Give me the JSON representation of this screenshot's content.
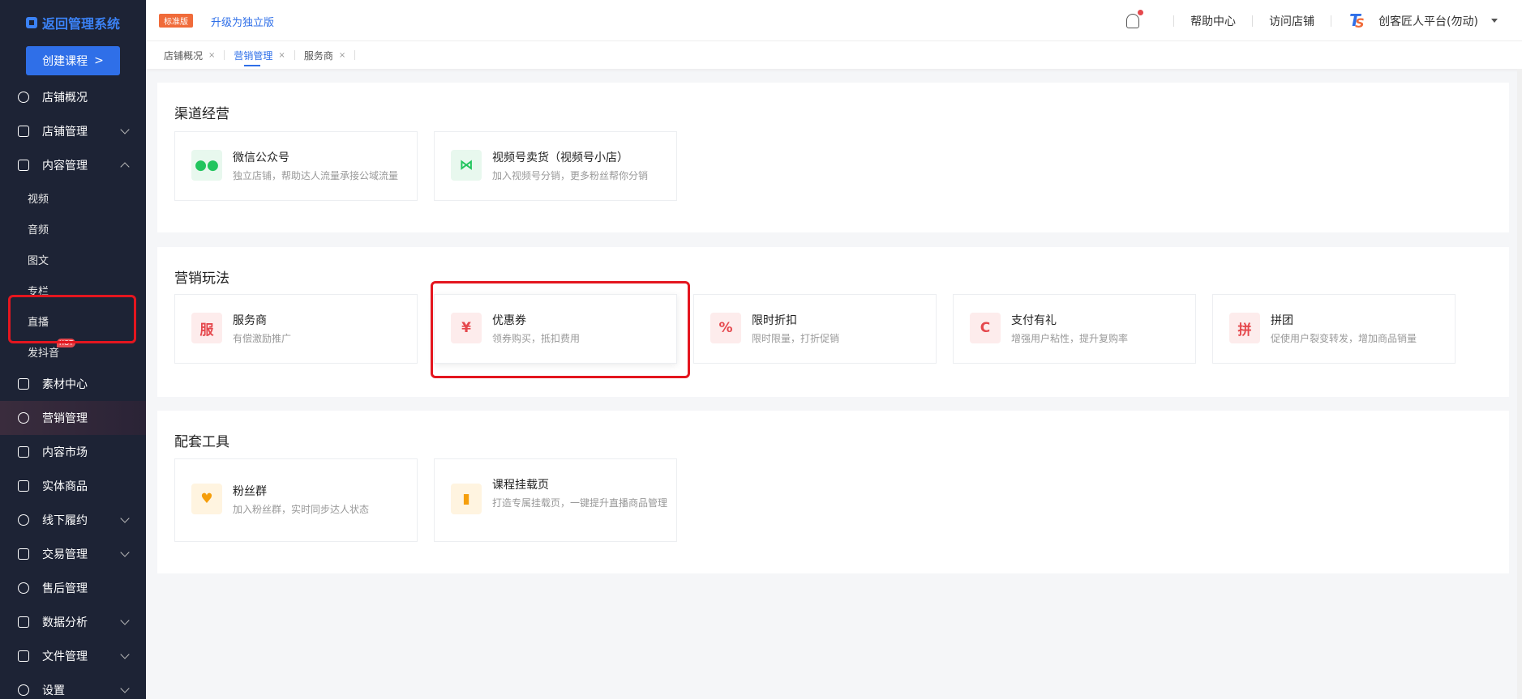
{
  "sidebar": {
    "brand": "返回管理系统",
    "create_button": "创建课程",
    "items": [
      {
        "label": "店铺概况"
      },
      {
        "label": "店铺管理"
      },
      {
        "label": "内容管理"
      },
      {
        "label": "素材中心"
      },
      {
        "label": "营销管理"
      },
      {
        "label": "内容市场"
      },
      {
        "label": "实体商品"
      },
      {
        "label": "线下履约"
      },
      {
        "label": "交易管理"
      },
      {
        "label": "售后管理"
      },
      {
        "label": "数据分析"
      },
      {
        "label": "文件管理"
      },
      {
        "label": "设置"
      }
    ],
    "content_sub": [
      "视频",
      "音频",
      "图文",
      "专栏",
      "直播",
      "发抖音"
    ],
    "hot_badge": "HOT"
  },
  "header": {
    "edition_badge": "标准版",
    "upgrade_link": "升级为独立版",
    "help": "帮助中心",
    "visit_store": "访问店铺",
    "account": "创客匠人平台(勿动)"
  },
  "tabs": [
    {
      "label": "店铺概况",
      "close": "×"
    },
    {
      "label": "营销管理",
      "close": "×"
    },
    {
      "label": "服务商",
      "close": "×"
    }
  ],
  "sections": {
    "channel": {
      "title": "渠道经营",
      "cards": [
        {
          "title": "微信公众号",
          "desc": "独立店铺，帮助达人流量承接公域流量",
          "icon": "wechat-icon"
        },
        {
          "title": "视频号卖货（视频号小店）",
          "desc": "加入视频号分销，更多粉丝帮你分销",
          "icon": "share-icon"
        }
      ]
    },
    "marketing": {
      "title": "营销玩法",
      "cards": [
        {
          "title": "服务商",
          "desc": "有偿激励推广",
          "icon": "service-provider-icon",
          "glyph": "服"
        },
        {
          "title": "优惠券",
          "desc": "领券购买，抵扣费用",
          "icon": "coupon-icon",
          "glyph": "¥"
        },
        {
          "title": "限时折扣",
          "desc": "限时限量，打折促销",
          "icon": "discount-icon",
          "glyph": "%"
        },
        {
          "title": "支付有礼",
          "desc": "增强用户粘性，提升复购率",
          "icon": "wallet-icon",
          "glyph": "C"
        },
        {
          "title": "拼团",
          "desc": "促使用户裂变转发，增加商品销量",
          "icon": "group-buy-icon",
          "glyph": "拼"
        }
      ]
    },
    "tools": {
      "title": "配套工具",
      "cards": [
        {
          "title": "粉丝群",
          "desc": "加入粉丝群，实时同步达人状态",
          "icon": "heart-plus-icon",
          "glyph": "♥"
        },
        {
          "title": "课程挂载页",
          "desc": "打造专属挂载页，一键提升直播商品管理",
          "icon": "book-icon",
          "glyph": "▮"
        }
      ]
    }
  },
  "colors": {
    "sidebar_bg": "#1d2335",
    "primary": "#2f6fe8",
    "highlight_box": "#e4161f"
  }
}
